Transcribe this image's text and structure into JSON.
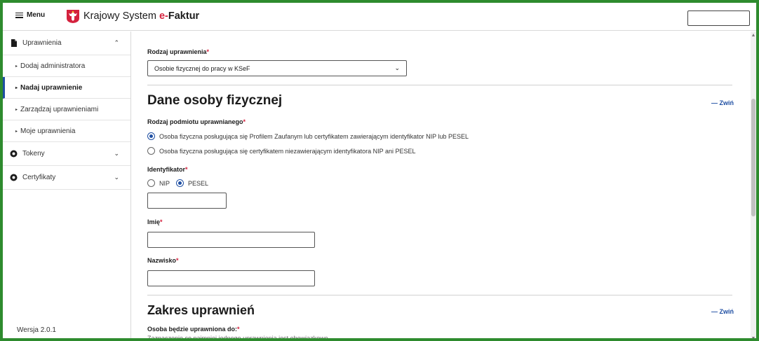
{
  "header": {
    "menu_label": "Menu",
    "title_plain": "Krajowy System ",
    "title_brand_e": "e-",
    "title_brand_rest": "Faktur"
  },
  "sidebar": {
    "groups": [
      {
        "label": "Uprawnienia",
        "icon": "document-icon"
      },
      {
        "label": "Tokeny",
        "icon": "circle-icon"
      },
      {
        "label": "Certyfikaty",
        "icon": "circle-icon"
      }
    ],
    "sub_items": [
      {
        "label": "Dodaj administratora"
      },
      {
        "label": "Nadaj uprawnienie",
        "active": true
      },
      {
        "label": "Zarządzaj uprawnieniami"
      },
      {
        "label": "Moje uprawnienia"
      }
    ],
    "version": "Wersja 2.0.1"
  },
  "form": {
    "rodzaj_label": "Rodzaj uprawnienia",
    "rodzaj_value": "Osobie fizycznej do pracy w KSeF",
    "section1_title": "Dane osoby fizycznej",
    "collapse_label": "— Zwiń",
    "podmiot_label": "Rodzaj podmiotu uprawnianego",
    "podmiot_options": [
      "Osoba fizyczna posługująca się Profilem Zaufanym lub certyfikatem zawierającym identyfikator NIP lub PESEL",
      "Osoba fizyczna posługująca się certyfikatem niezawierającym identyfikatora NIP ani PESEL"
    ],
    "podmiot_selected": 0,
    "identyfikator_label": "Identyfikator",
    "identyfikator_options": [
      "NIP",
      "PESEL"
    ],
    "identyfikator_selected": 1,
    "identyfikator_value": "",
    "imie_label": "Imię",
    "imie_value": "",
    "nazwisko_label": "Nazwisko",
    "nazwisko_value": "",
    "section2_title": "Zakres uprawnień",
    "zakres_label": "Osoba będzie uprawniona do:",
    "zakres_hint": "Zaznaczenie co najmniej jednego uprawnienia jest obowiązkowe"
  },
  "colors": {
    "accent": "#1f4fa3",
    "required": "#d4213d",
    "frame": "#2e8b2e"
  }
}
